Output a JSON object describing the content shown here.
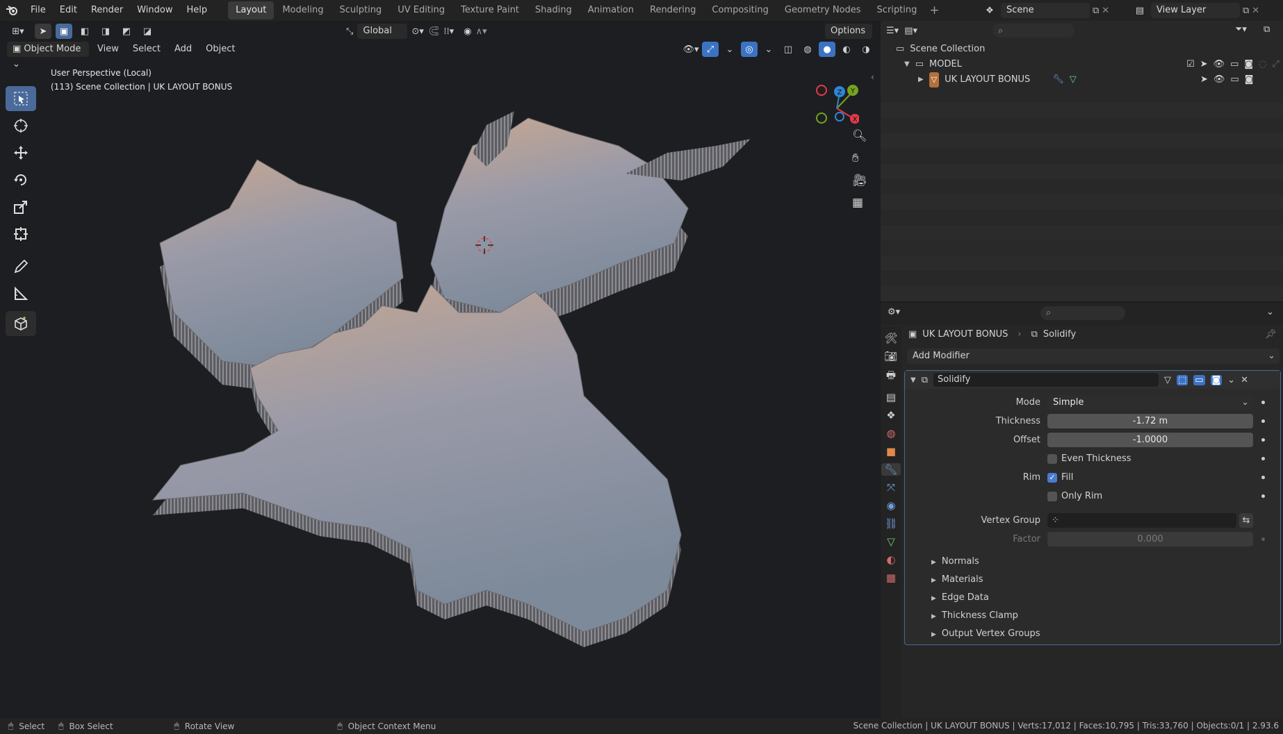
{
  "menu": {
    "items": [
      "File",
      "Edit",
      "Render",
      "Window",
      "Help"
    ]
  },
  "workspaces": {
    "tabs": [
      "Layout",
      "Modeling",
      "Sculpting",
      "UV Editing",
      "Texture Paint",
      "Shading",
      "Animation",
      "Rendering",
      "Compositing",
      "Geometry Nodes",
      "Scripting"
    ],
    "active": "Layout"
  },
  "scene": {
    "name": "Scene",
    "view_layer": "View Layer"
  },
  "viewport": {
    "transform_orientation": "Global",
    "options_label": "Options",
    "mode": "Object Mode",
    "menus": [
      "View",
      "Select",
      "Add",
      "Object"
    ],
    "overlay_line1": "User Perspective (Local)",
    "overlay_line2": "(113) Scene Collection | UK LAYOUT BONUS",
    "gizmo": {
      "z": "Z",
      "y": "Y",
      "x": "X"
    }
  },
  "outliner": {
    "root": "Scene Collection",
    "collection": "MODEL",
    "object": "UK LAYOUT BONUS"
  },
  "properties": {
    "breadcrumb_object": "UK LAYOUT BONUS",
    "breadcrumb_modifier": "Solidify",
    "add_modifier": "Add Modifier",
    "modifier_name": "Solidify",
    "rows": {
      "mode_label": "Mode",
      "mode_value": "Simple",
      "thickness_label": "Thickness",
      "thickness_value": "-1.72 m",
      "offset_label": "Offset",
      "offset_value": "-1.0000",
      "even_thickness": "Even Thickness",
      "rim_label": "Rim",
      "fill": "Fill",
      "only_rim": "Only Rim",
      "vertex_group_label": "Vertex Group",
      "factor_label": "Factor",
      "factor_value": "0.000"
    },
    "checks": {
      "even_thickness": false,
      "fill": true,
      "only_rim": false
    },
    "subpanels": [
      "Normals",
      "Materials",
      "Edge Data",
      "Thickness Clamp",
      "Output Vertex Groups"
    ]
  },
  "status": {
    "select": "Select",
    "box_select": "Box Select",
    "rotate_view": "Rotate View",
    "context_menu": "Object Context Menu",
    "stats": "Scene Collection | UK LAYOUT BONUS | Verts:17,012 | Faces:10,795 | Tris:33,760 | Objects:0/1 | 2.93.6"
  },
  "colors": {
    "accent": "#4a6a9a",
    "axis_x": "#e33a4b",
    "axis_y": "#74a320",
    "axis_z": "#2d86d6",
    "active_tab_blue": "#3b73c4",
    "check_blue": "#4b7bd0"
  }
}
